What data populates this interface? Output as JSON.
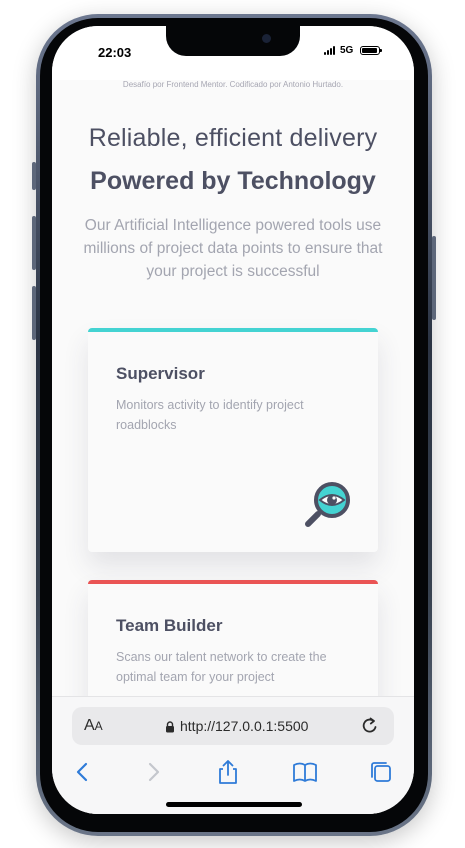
{
  "status_bar": {
    "time": "22:03",
    "network": "5G"
  },
  "page": {
    "attribution": "Desafío por Frontend Mentor. Codificado por Antonio Hurtado.",
    "heading_light": "Reliable, efficient delivery",
    "heading_bold": "Powered by Technology",
    "intro": "Our Artificial Intelligence powered tools use millions of project data points to ensure that your project is successful",
    "cards": [
      {
        "title": "Supervisor",
        "description": "Monitors activity to identify project roadblocks",
        "accent": "#44d3d2",
        "icon": "magnifier-eye-icon"
      },
      {
        "title": "Team Builder",
        "description": "Scans our talent network to create the optimal team for your project",
        "accent": "#ea5454"
      }
    ]
  },
  "browser": {
    "text_size_label_large": "A",
    "text_size_label_small": "A",
    "url": "http://127.0.0.1:5500",
    "accent": "#2f7bd8"
  },
  "colors": {
    "heading": "#4d5063",
    "body_text": "#a3a5b0",
    "background": "#fafafa"
  }
}
